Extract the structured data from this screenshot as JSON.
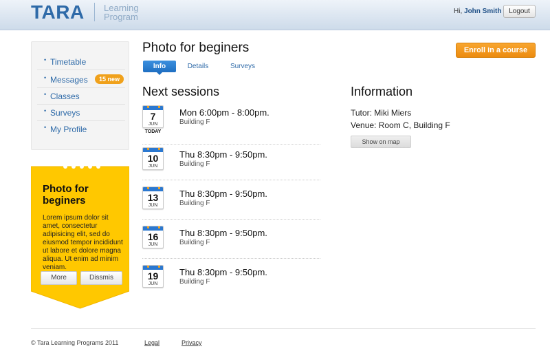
{
  "header": {
    "logo": "TARA",
    "logo_sub_line1": "Learning",
    "logo_sub_line2": "Program",
    "greeting_prefix": "Hi,",
    "user_name": "John Smith",
    "logout_label": "Logout"
  },
  "sidebar": {
    "items": [
      {
        "label": "Timetable"
      },
      {
        "label": "Messages",
        "badge": "15 new"
      },
      {
        "label": "Classes"
      },
      {
        "label": "Surveys"
      },
      {
        "label": "My Profile"
      }
    ]
  },
  "promo": {
    "title": "Photo for beginers",
    "body": "Lorem ipsum dolor sit amet, consectetur adipisicing elit, sed do eiusmod tempor incididunt ut labore et dolore magna aliqua. Ut enim ad minim veniam.",
    "more_label": "More",
    "dismiss_label": "Dissmis",
    "color": "#ffc800"
  },
  "main": {
    "title": "Photo for beginers",
    "enroll_label": "Enroll in a course",
    "tabs": [
      {
        "label": "Info",
        "active": true
      },
      {
        "label": "Details",
        "active": false
      },
      {
        "label": "Surveys",
        "active": false
      }
    ],
    "sessions_title": "Next sessions",
    "sessions": [
      {
        "day": "7",
        "month": "JUN",
        "today": "TODAY",
        "time": "Mon 6:00pm - 8:00pm.",
        "place": "Building F"
      },
      {
        "day": "10",
        "month": "JUN",
        "time": "Thu 8:30pm - 9:50pm.",
        "place": "Building F"
      },
      {
        "day": "13",
        "month": "JUN",
        "time": "Thu 8:30pm - 9:50pm.",
        "place": "Building F"
      },
      {
        "day": "16",
        "month": "JUN",
        "time": "Thu 8:30pm - 9:50pm.",
        "place": "Building F"
      },
      {
        "day": "19",
        "month": "JUN",
        "time": "Thu 8:30pm - 9:50pm.",
        "place": "Building F"
      }
    ],
    "info_title": "Information",
    "tutor": "Tutor: Miki Miers",
    "venue": "Venue: Room C, Building F",
    "show_map_label": "Show on map"
  },
  "footer": {
    "copyright": "© Tara Learning Programs 2011",
    "links": [
      "Legal",
      "Privacy"
    ]
  },
  "colors": {
    "brand": "#2e6aa8",
    "accent_orange": "#f0a11b",
    "calendar_blue": "#2b78d0"
  }
}
